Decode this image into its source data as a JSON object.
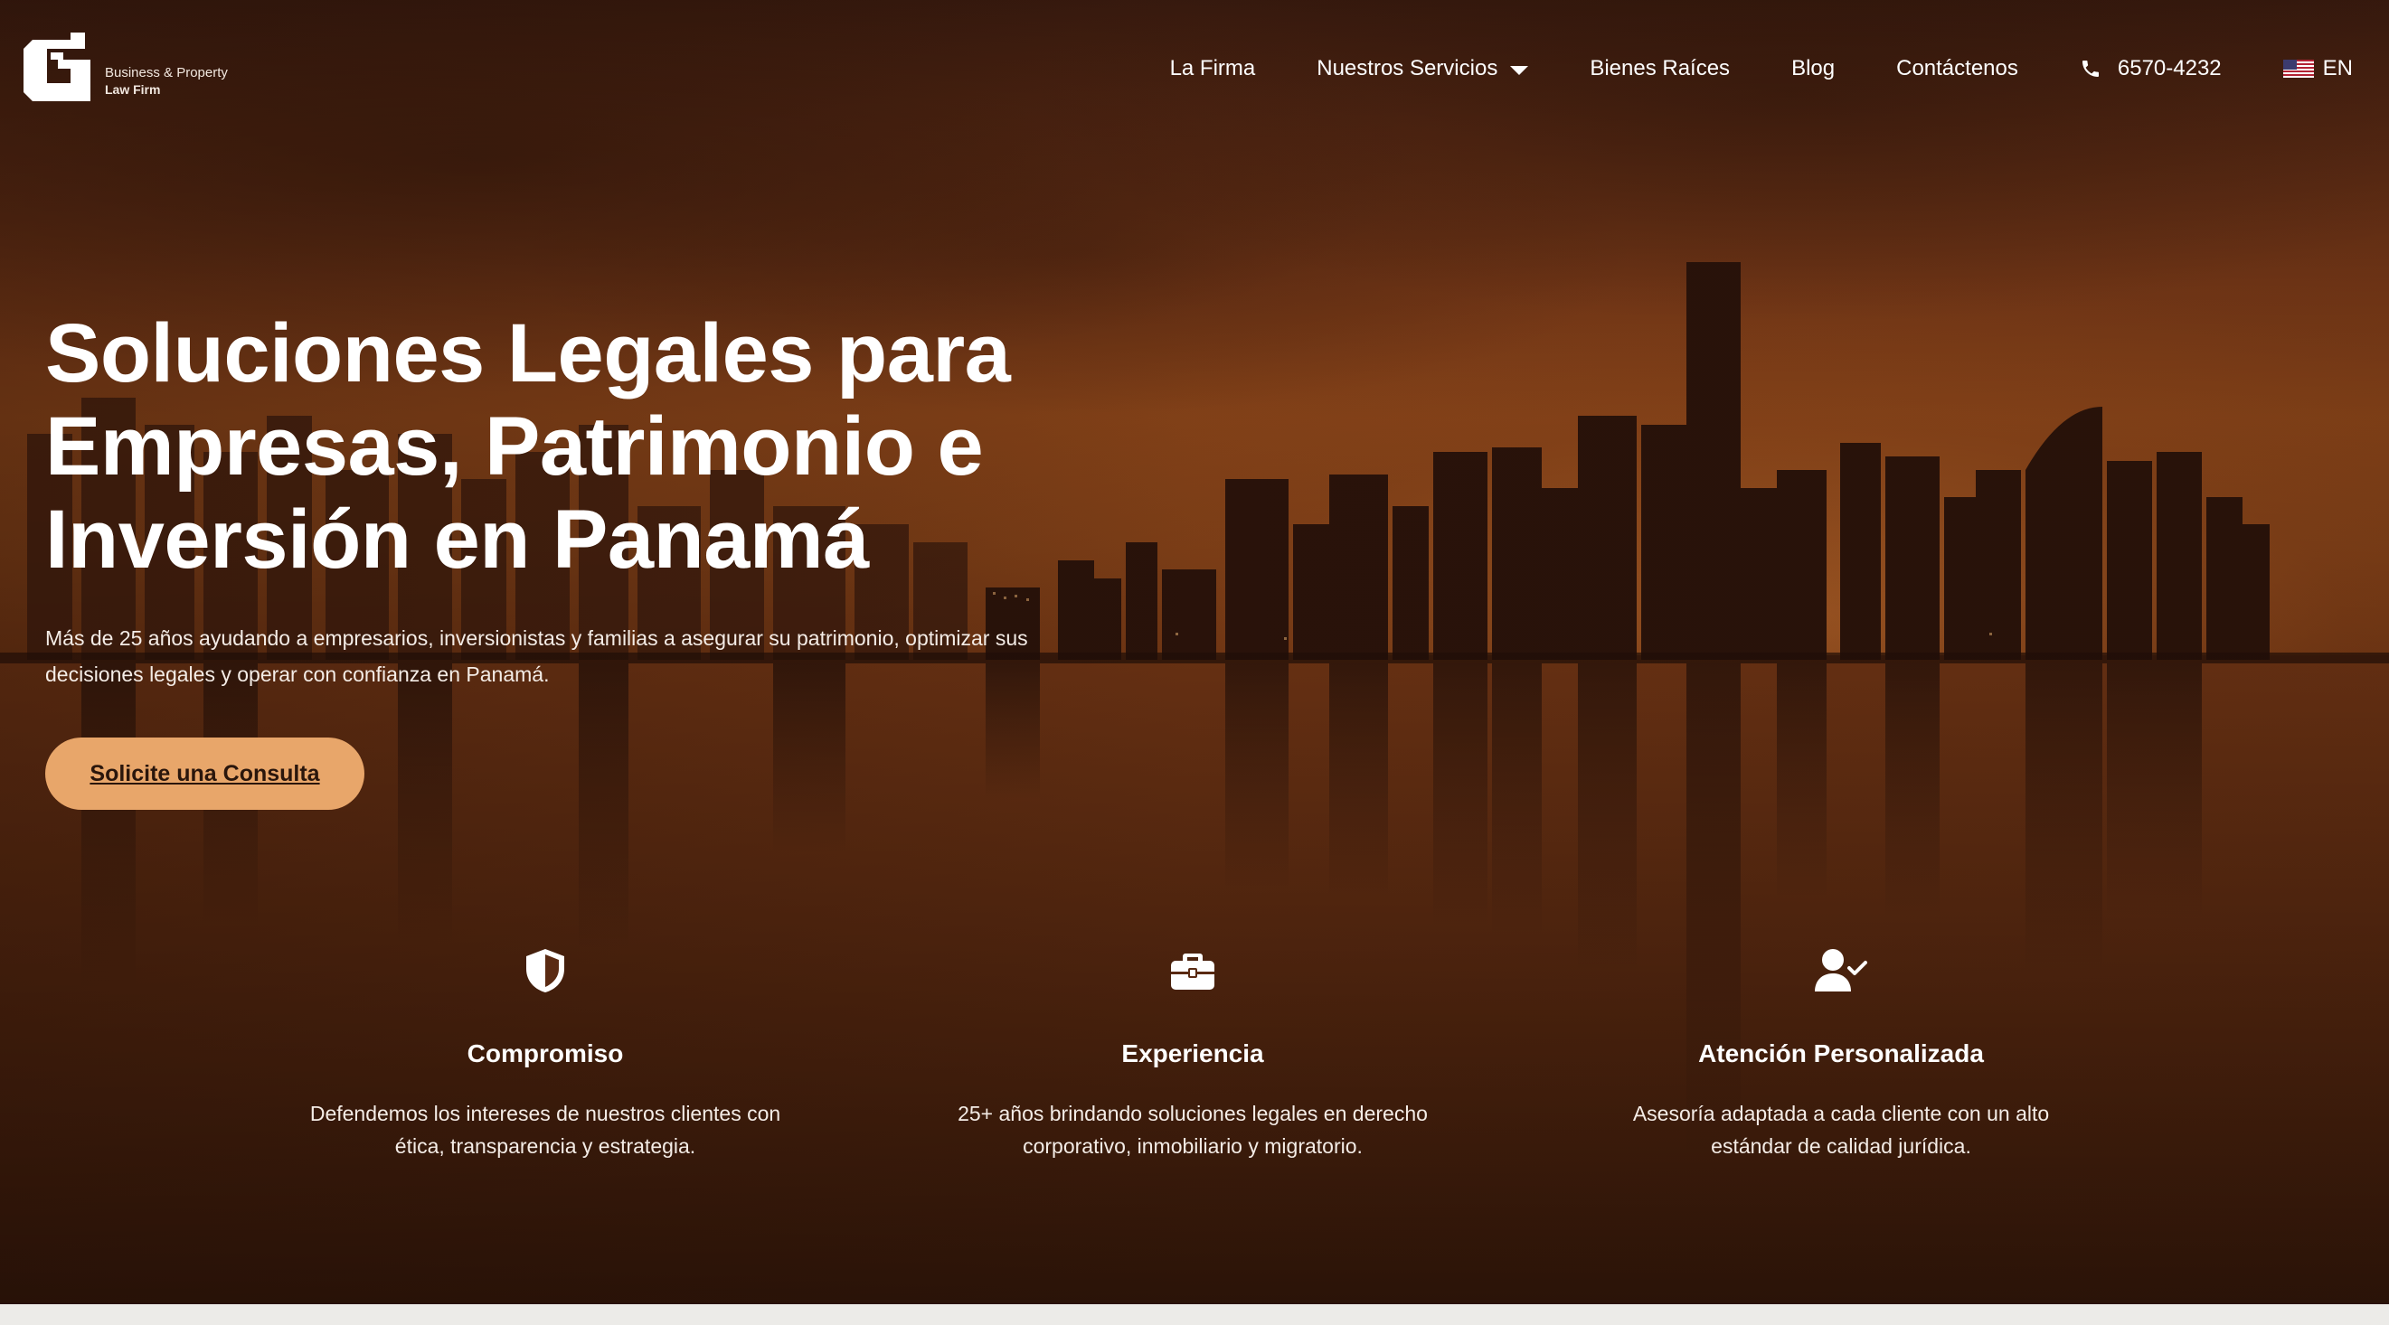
{
  "brand": {
    "tagline_line1": "Business & Property",
    "tagline_line2": "Law Firm",
    "logo_icon": "firm-monogram-logo"
  },
  "nav": {
    "items": [
      {
        "label": "La Firma"
      },
      {
        "label": "Nuestros Servicios",
        "has_dropdown": true
      },
      {
        "label": "Bienes Raíces"
      },
      {
        "label": "Blog"
      },
      {
        "label": "Contáctenos"
      }
    ],
    "phone": "6570-4232",
    "phone_icon": "phone-icon",
    "language": "EN",
    "language_icon": "us-flag-icon"
  },
  "hero": {
    "headline_line1": "Soluciones Legales para",
    "headline_line2": "Empresas, Patrimonio e",
    "headline_line3": "Inversión en Panamá",
    "subtext_line1": "Más de 25 años ayudando a empresarios, inversionistas y familias a asegurar su patrimonio, optimizar sus",
    "subtext_line2": "decisiones legales y operar con confianza en Panamá.",
    "cta_label": "Solicite una Consulta"
  },
  "features": [
    {
      "icon": "shield-icon",
      "title": "Compromiso",
      "desc_line1": "Defendemos los intereses de nuestros clientes con",
      "desc_line2": "ética, transparencia y estrategia."
    },
    {
      "icon": "briefcase-icon",
      "title": "Experiencia",
      "desc_line1": "25+ años brindando soluciones legales en derecho",
      "desc_line2": "corporativo, inmobiliario y migratorio."
    },
    {
      "icon": "user-check-icon",
      "title": "Atención Personalizada",
      "desc_line1": "Asesoría adaptada a cada cliente con un alto",
      "desc_line2": "estándar de calidad jurídica."
    }
  ],
  "colors": {
    "cta_background": "#e8a66a",
    "hero_tone": "#7a3a18",
    "text": "#ffffff"
  }
}
